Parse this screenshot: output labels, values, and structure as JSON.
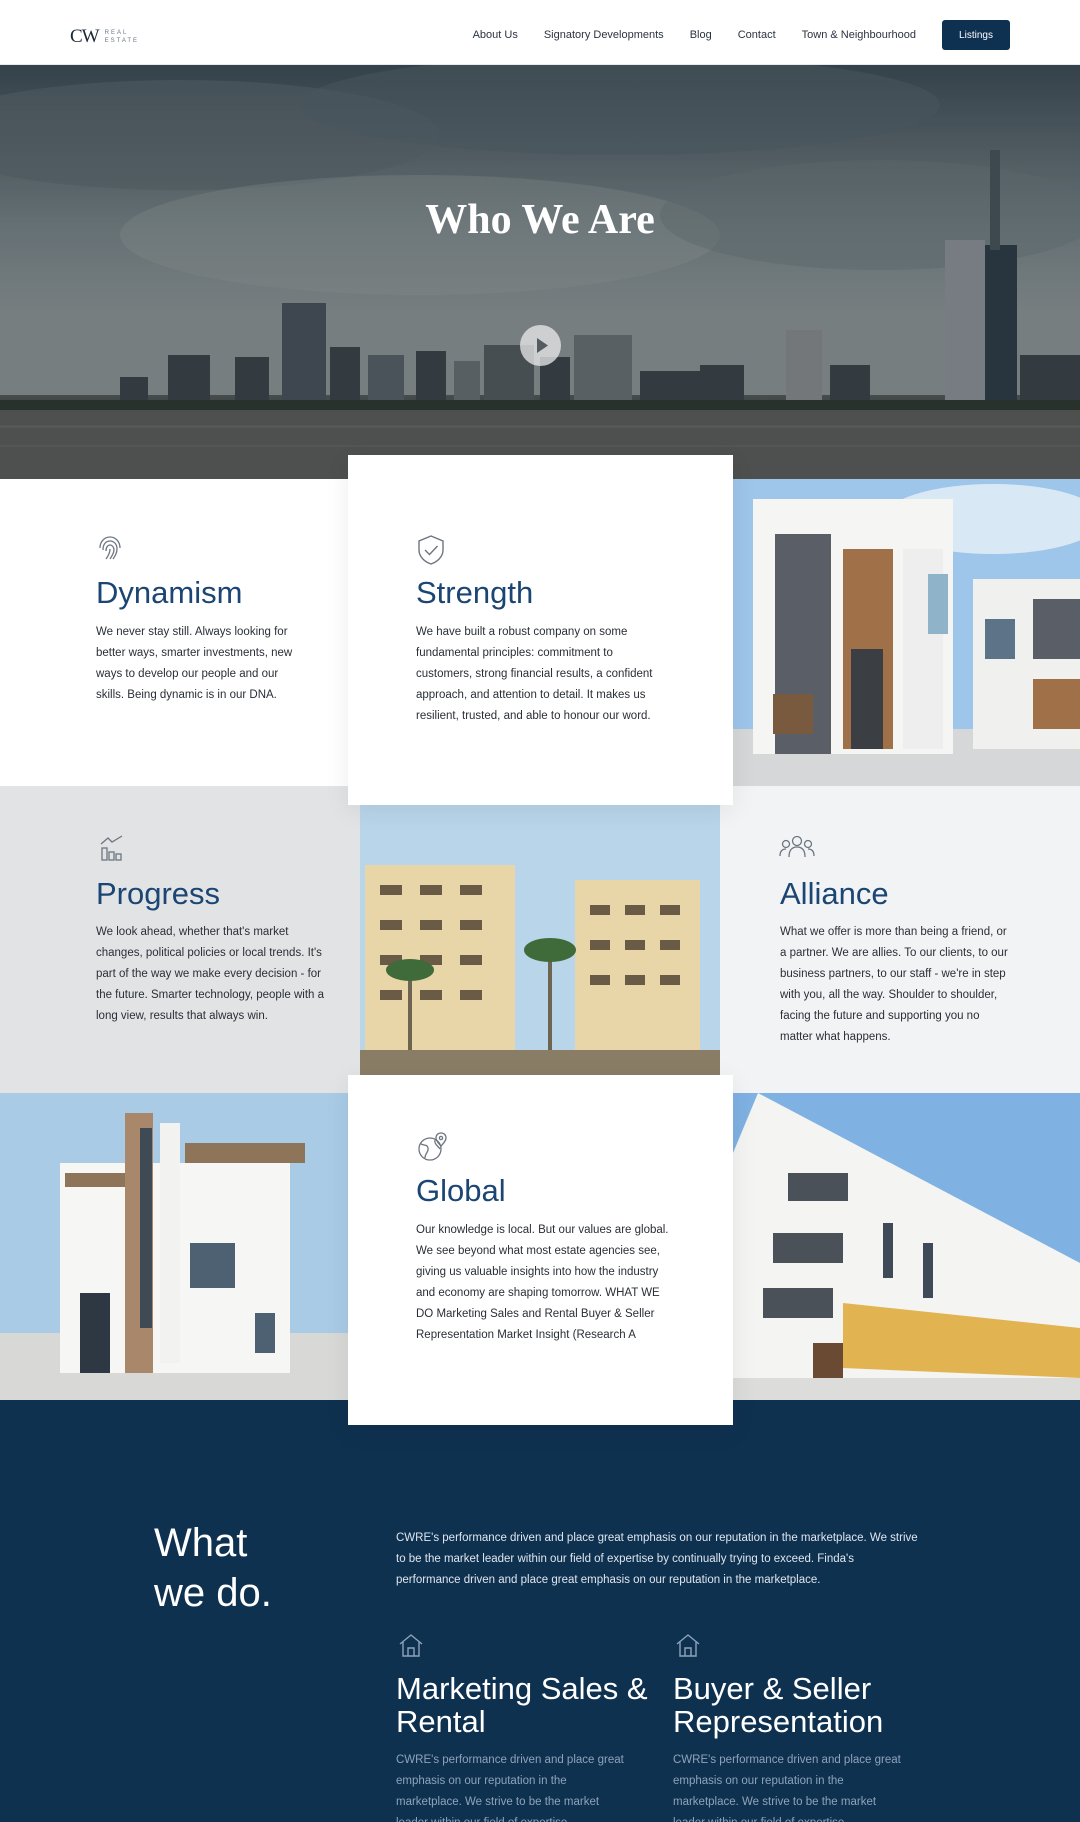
{
  "nav": {
    "logo_mark": "CW",
    "logo_sub": "REAL ESTATE",
    "links": [
      "About Us",
      "Signatory Developments",
      "Blog",
      "Contact",
      "Town & Neighbourhood"
    ],
    "cta": "Listings"
  },
  "hero": {
    "title": "Who We  Are",
    "play_icon": "play-icon"
  },
  "values": [
    {
      "icon": "fingerprint-icon",
      "title": "Dynamism",
      "text": "We never stay still. Always looking for better ways, smarter investments, new ways to develop our people and our skills. Being dynamic is in our DNA."
    },
    {
      "icon": "shield-check-icon",
      "title": "Strength",
      "text": "We have built a robust company on some fundamental principles: commitment to customers, strong financial results, a confident approach, and attention to detail. It makes us resilient, trusted, and able to honour our word."
    },
    {
      "icon": "growth-chart-icon",
      "title": "Progress",
      "text": "We look ahead, whether that's market changes, political policies or local trends. It's part of the way we make every decision - for the future. Smarter technology, people with a long view, results that always win."
    },
    {
      "icon": "people-group-icon",
      "title": "Alliance",
      "text": "What we offer is more than being a friend, or a partner. We are allies. To our clients, to our business partners, to our staff - we're in step with you, all the way. Shoulder to shoulder, facing the future and supporting you no matter what happens."
    },
    {
      "icon": "globe-pin-icon",
      "title": "Global",
      "text": "Our knowledge is local. But our values are global. We see beyond what most estate agencies see, giving us valuable insights into how the industry and economy are shaping tomorrow. WHAT WE DO Marketing Sales and Rental Buyer & Seller Representation Market Insight (Research A"
    }
  ],
  "what_we_do": {
    "title_line1": "What",
    "title_line2": "we do.",
    "intro": "CWRE's performance driven and place great emphasis on our reputation in the marketplace. We strive to be the market leader within our field of expertise by continually trying to exceed. Finda's performance driven and place great emphasis on our reputation in the marketplace.",
    "services": [
      {
        "icon": "house-icon",
        "title": "Marketing Sales & Rental",
        "text": "CWRE's performance driven and place great emphasis on our reputation in the marketplace. We strive to be the market leader within our field of expertise."
      },
      {
        "icon": "house-icon",
        "title": "Buyer & Seller Representation",
        "text": "CWRE's performance driven and place great emphasis on our reputation in the marketplace. We strive to be the market leader within our field of expertise."
      }
    ]
  },
  "colors": {
    "navy": "#0f3150",
    "accent_title": "#1b4572",
    "button": "#0e3152"
  }
}
